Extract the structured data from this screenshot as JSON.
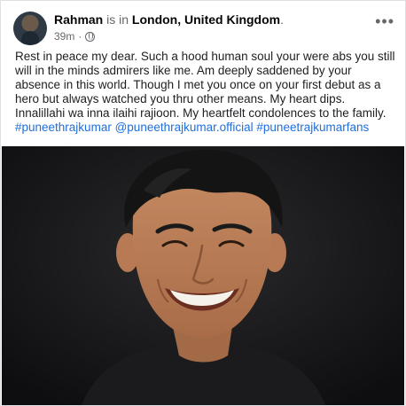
{
  "post": {
    "author": "Rahman",
    "is_in": " is in ",
    "location": "London, United Kingdom",
    "location_suffix": ".",
    "time": "39m",
    "dot": "·",
    "more_icon": "more-icon",
    "privacy_icon": "globe-icon",
    "text_lines": [
      "Rest in peace my dear. Such a hood human soul your were abs you still",
      "will in the minds admirers like me. Am deeply saddened by your",
      "absence in this world. Though I met you once on your first debut as a",
      "hero but always watched you thru other means. My heart dips.",
      "Innalillahi wa inna ilaihi rajioon. My heartfelt condolences to the family."
    ],
    "hashtags": [
      "#puneethrajkumar",
      "@puneethrajkumar.official",
      "#puneetrajkumarfans"
    ]
  }
}
